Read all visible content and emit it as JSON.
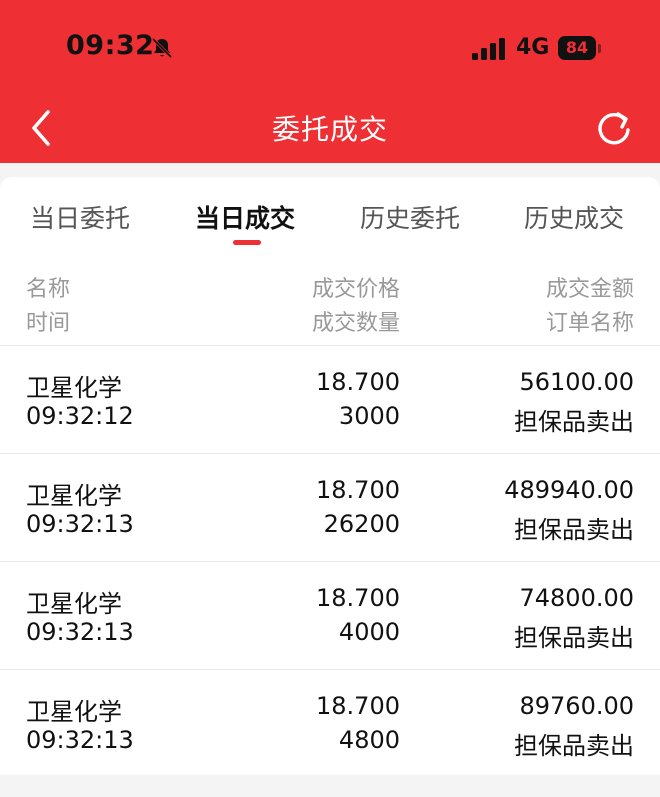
{
  "status_bar": {
    "time": "09:32",
    "network": "4G",
    "battery": "84"
  },
  "nav": {
    "title": "委托成交"
  },
  "tabs": [
    {
      "label": "当日委托",
      "active": false
    },
    {
      "label": "当日成交",
      "active": true
    },
    {
      "label": "历史委托",
      "active": false
    },
    {
      "label": "历史成交",
      "active": false
    }
  ],
  "table": {
    "headers": {
      "name": "名称",
      "time": "时间",
      "price": "成交价格",
      "quantity": "成交数量",
      "amount": "成交金额",
      "order_name": "订单名称"
    },
    "rows": [
      {
        "name": "卫星化学",
        "time": "09:32:12",
        "price": "18.700",
        "quantity": "3000",
        "amount": "56100.00",
        "order_name": "担保品卖出"
      },
      {
        "name": "卫星化学",
        "time": "09:32:13",
        "price": "18.700",
        "quantity": "26200",
        "amount": "489940.00",
        "order_name": "担保品卖出"
      },
      {
        "name": "卫星化学",
        "time": "09:32:13",
        "price": "18.700",
        "quantity": "4000",
        "amount": "74800.00",
        "order_name": "担保品卖出"
      },
      {
        "name": "卫星化学",
        "time": "09:32:13",
        "price": "18.700",
        "quantity": "4800",
        "amount": "89760.00",
        "order_name": "担保品卖出"
      }
    ]
  },
  "colors": {
    "brand_red": "#ee2f33",
    "text_primary": "#111111",
    "text_secondary": "#999999"
  },
  "icons": {
    "bell": "bell-muted-icon",
    "signal": "cellular-signal-icon",
    "back": "chevron-left-icon",
    "refresh": "refresh-icon"
  }
}
